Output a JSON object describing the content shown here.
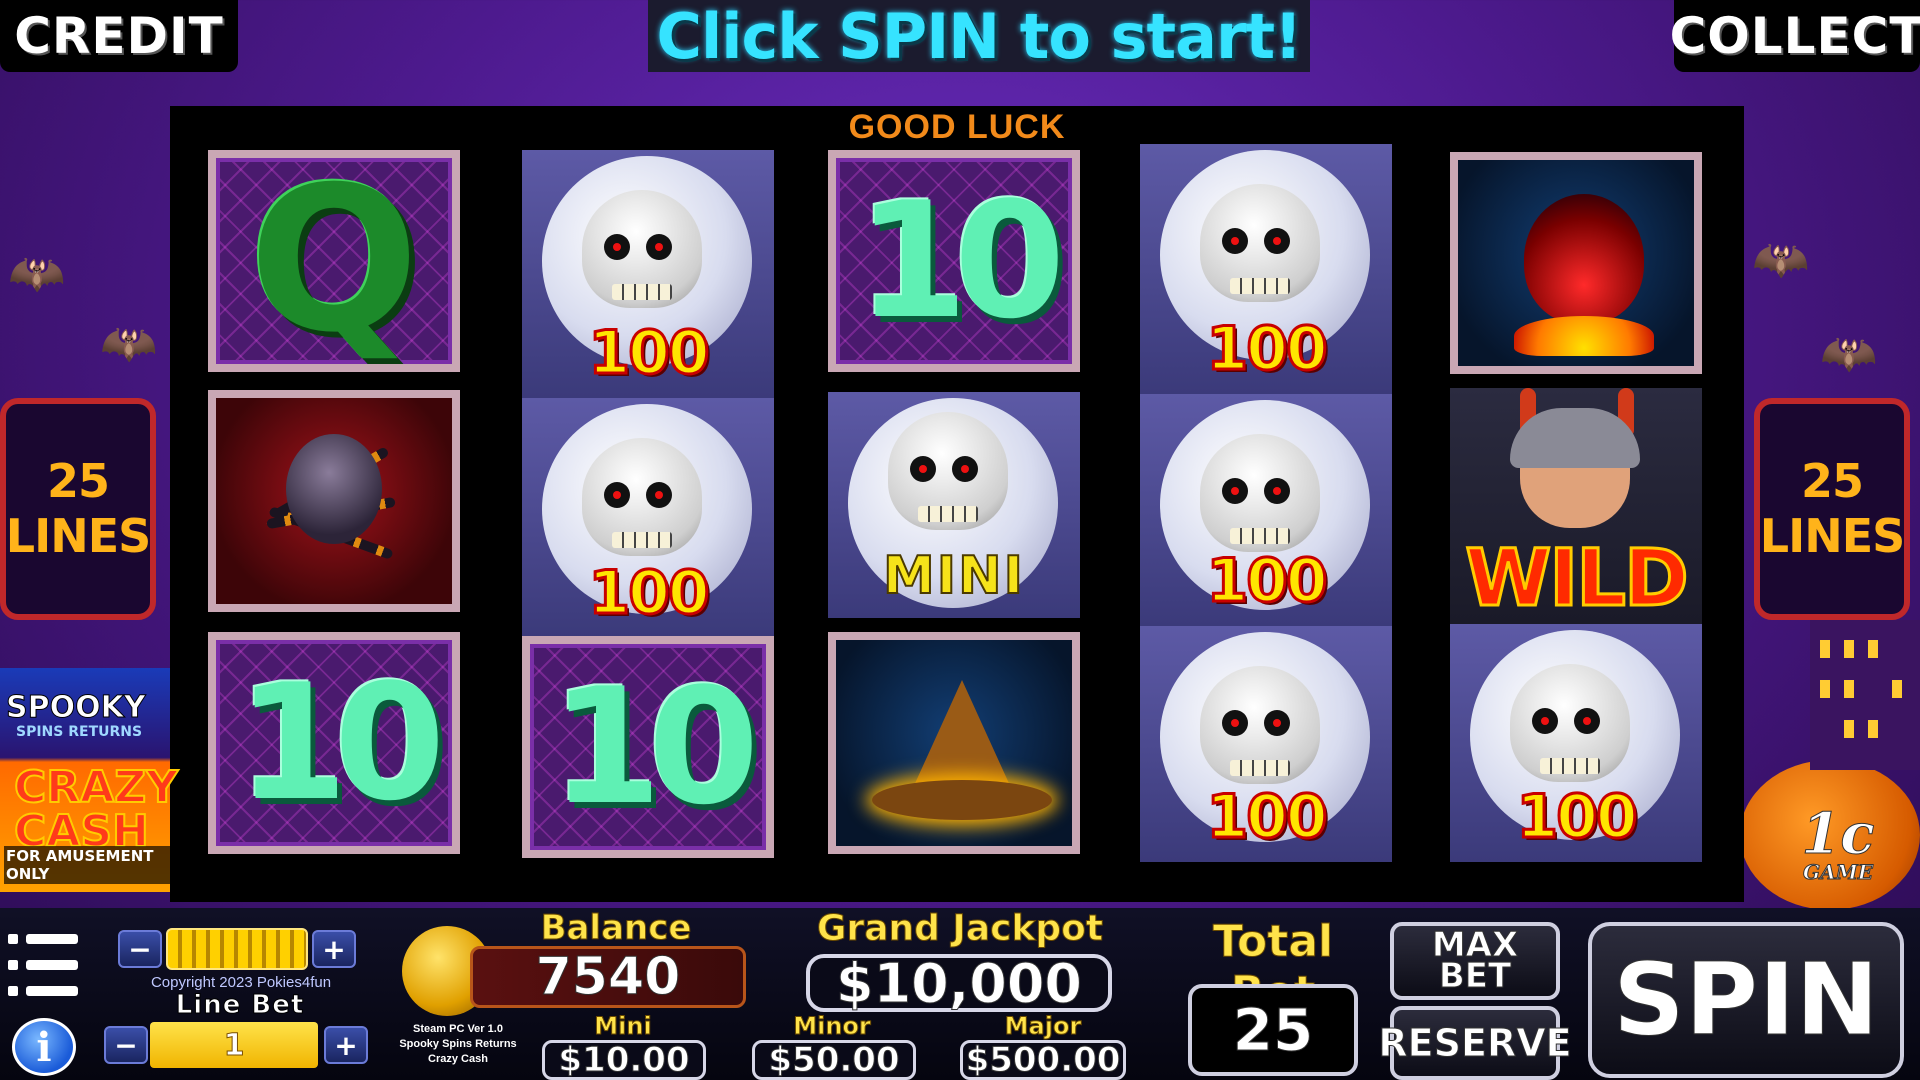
{
  "header": {
    "credit_label": "CREDIT",
    "collect_label": "COLLECT",
    "headline": "Click SPIN to start!"
  },
  "reels": {
    "good_luck": "GOOD LUCK",
    "grid": [
      [
        "Q",
        "skull-100",
        "10",
        "skull-100",
        "potion"
      ],
      [
        "spider",
        "skull-100",
        "skull-mini",
        "skull-100",
        "wild"
      ],
      [
        "10",
        "10",
        "witch-hat",
        "skull-100",
        "skull-100"
      ]
    ],
    "skull_value": "100",
    "mini_label": "MINI",
    "wild_label": "WILD",
    "q_label": "Q",
    "ten_label": "10"
  },
  "side": {
    "lines_count": "25",
    "lines_word": "LINES"
  },
  "logo": {
    "line1": "SPOOKY",
    "line2": "SPINS RETURNS",
    "line3": "CRAZY CASH",
    "line4": "FOR AMUSEMENT ONLY"
  },
  "game_logo": {
    "big": "1c",
    "small": "GAME"
  },
  "bottom": {
    "copyright": "Copyright 2023 Pokies4fun",
    "line_bet_label": "Line Bet",
    "line_bet_value": "1",
    "version_lines": [
      "Steam PC Ver 1.0",
      "Spooky Spins Returns",
      "Crazy Cash"
    ],
    "balance_label": "Balance",
    "balance_value": "7540",
    "grand_jackpot_label": "Grand Jackpot",
    "grand_jackpot_value": "$10,000",
    "mini_jackpot_label": "Mini Jackpot",
    "mini_jackpot_value": "$10.00",
    "minor_jackpot_label": "Minor Jackpot",
    "minor_jackpot_value": "$50.00",
    "major_jackpot_label": "Major Jackpot",
    "major_jackpot_value": "$500.00",
    "total_bet_label": "Total Bet",
    "total_bet_value": "25",
    "max_bet_label": "MAX BET",
    "reserve_label": "RESERVE",
    "spin_label": "SPIN",
    "minus": "−",
    "plus": "+",
    "info": "i"
  },
  "colors": {
    "headline": "#36e3ff",
    "good_luck": "#f28a1a",
    "lines_text": "#ffb31a",
    "lines_border": "#c0282a",
    "gold_label": "#ffe34a"
  }
}
